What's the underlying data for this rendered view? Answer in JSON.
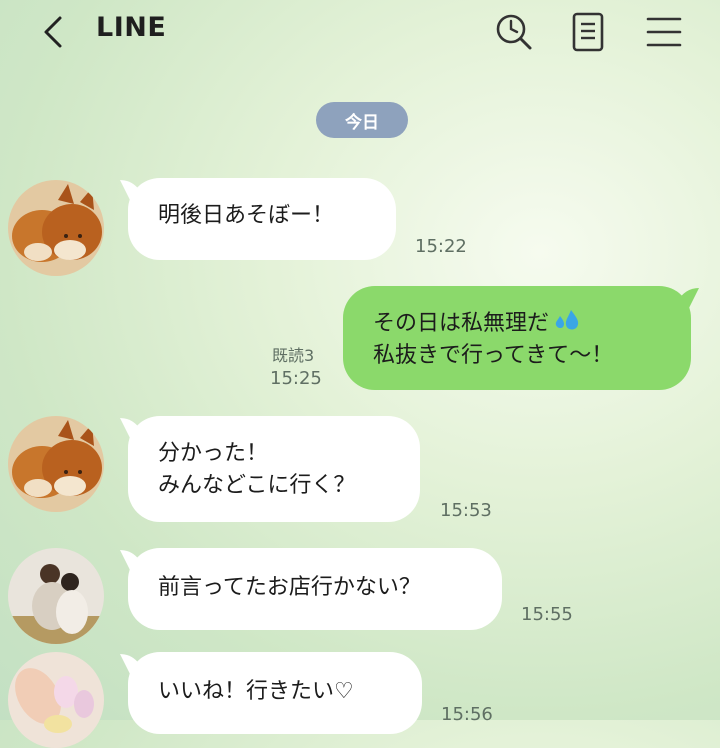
{
  "header": {
    "title": "LINE",
    "back_icon": "chevron-left-icon",
    "search_icon": "search-icon",
    "notes_icon": "note-icon",
    "menu_icon": "menu-icon"
  },
  "date_separator": "今日",
  "colors": {
    "incoming_bubble": "#ffffff",
    "outgoing_bubble": "#8bd96b",
    "date_pill": "#8ea2bd"
  },
  "messages": [
    {
      "direction": "incoming",
      "avatar": "shiba-dogs-avatar",
      "lines": [
        "明後日あそぼー！"
      ],
      "time": "15:22"
    },
    {
      "direction": "outgoing",
      "lines": [
        "その日は私無理だ",
        "私抜きで行ってきて〜！"
      ],
      "emoji": "sweat-droplets-icon",
      "read_label": "既読3",
      "time": "15:25"
    },
    {
      "direction": "incoming",
      "avatar": "shiba-dogs-avatar",
      "lines": [
        "分かった！",
        "みんなどこに行く？"
      ],
      "time": "15:53"
    },
    {
      "direction": "incoming",
      "avatar": "couple-photo-avatar",
      "lines": [
        "前言ってたお店行かない？"
      ],
      "time": "15:55"
    },
    {
      "direction": "incoming",
      "avatar": "nails-photo-avatar",
      "lines": [
        "いいね！行きたい♡"
      ],
      "time": "15:56"
    }
  ]
}
